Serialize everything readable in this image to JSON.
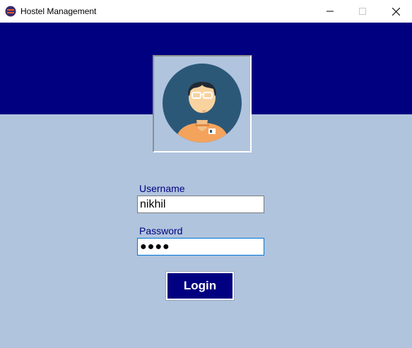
{
  "window": {
    "title": "Hostel Management",
    "app_icon": "hostel-app-icon",
    "controls": {
      "minimize_icon": "minimize-icon",
      "maximize_icon": "maximize-icon",
      "close_icon": "close-icon"
    }
  },
  "colors": {
    "banner": "#000080",
    "background": "#b0c4de",
    "label": "#000080",
    "button": "#000080",
    "focus_border": "#0078d7"
  },
  "avatar": {
    "icon": "user-avatar-icon"
  },
  "form": {
    "username_label": "Username",
    "username_value": "nikhil",
    "password_label": "Password",
    "password_value": "●●●●",
    "login_label": "Login"
  }
}
